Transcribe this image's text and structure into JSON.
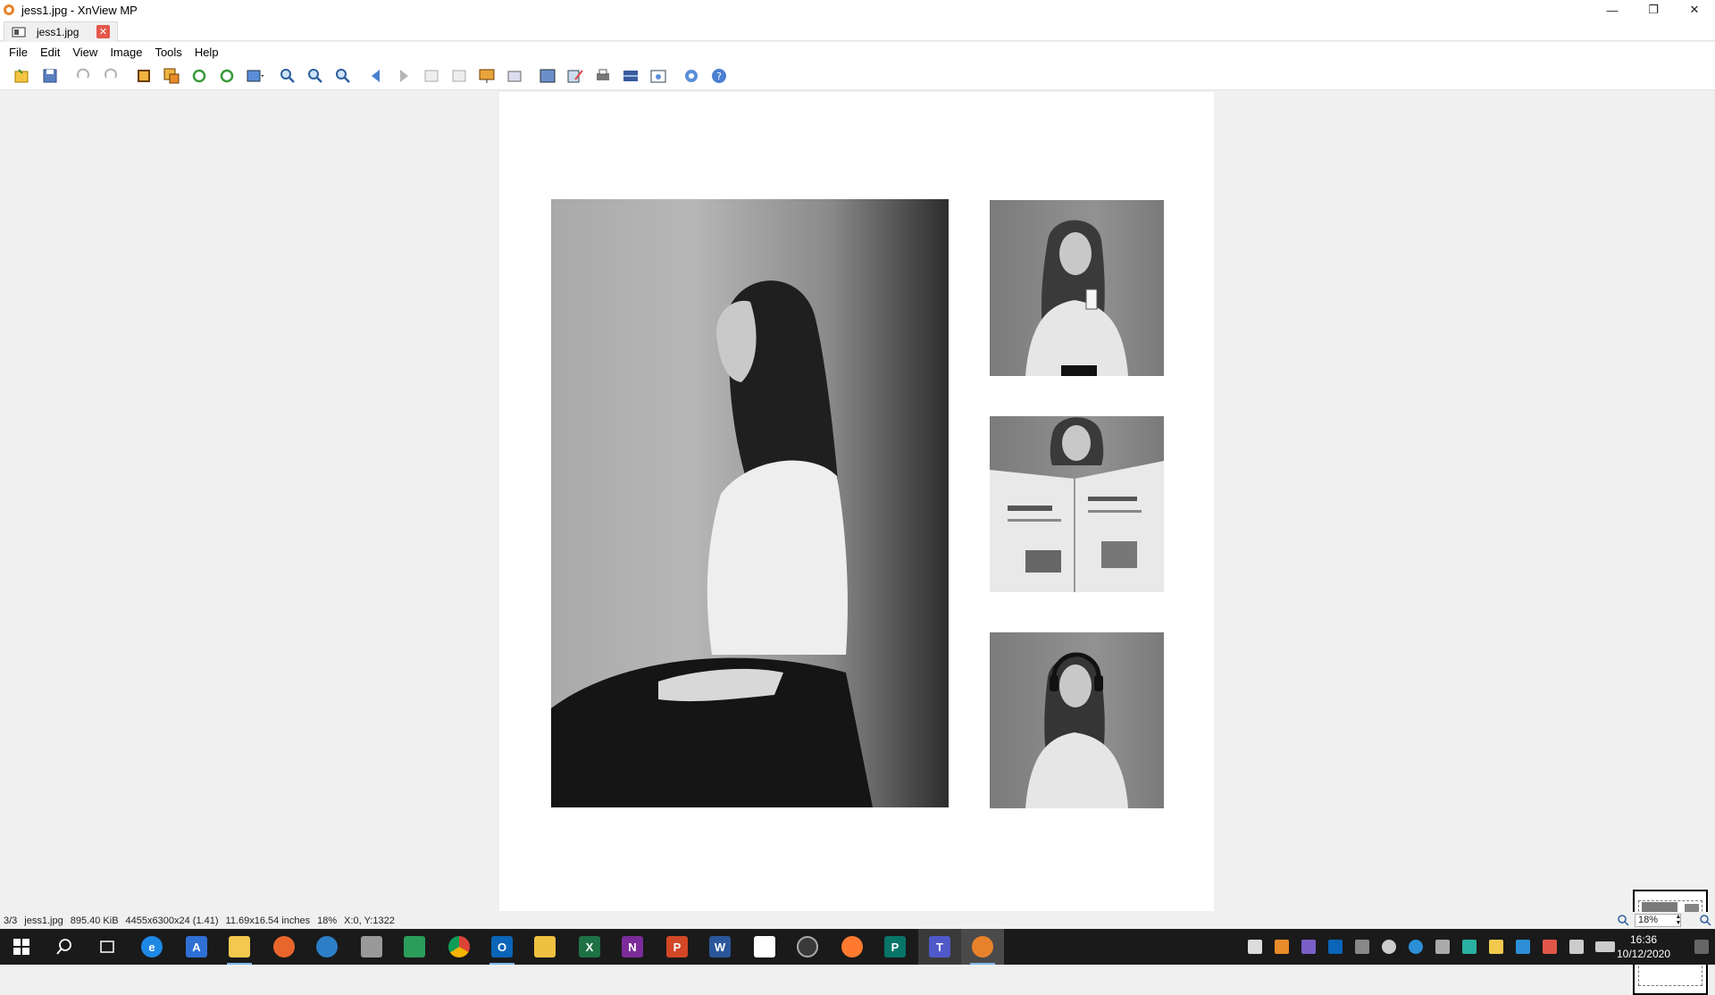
{
  "window": {
    "title": "jess1.jpg - XnView MP",
    "controls": [
      "minimize",
      "restore",
      "close"
    ]
  },
  "tab": {
    "label": "jess1.jpg"
  },
  "menu": [
    "File",
    "Edit",
    "View",
    "Image",
    "Tools",
    "Help"
  ],
  "toolbar": {
    "icons": [
      "browser-icon",
      "save-icon",
      "undo-icon",
      "redo-icon",
      "crop-icon",
      "resize-icon",
      "rotate-left-icon",
      "rotate-right-icon",
      "adjust-icon",
      "zoom-in-icon",
      "zoom-fit-icon",
      "zoom-out-icon",
      "previous-icon",
      "next-icon",
      "first-icon",
      "last-icon",
      "slideshow-icon",
      "fullscreen-icon",
      "compare-icon",
      "edit-icon",
      "print-icon",
      "scan-icon",
      "capture-icon",
      "settings-icon",
      "help-icon"
    ]
  },
  "statusbar": {
    "index": "3/3",
    "filename": "jess1.jpg",
    "filesize": "895.40 KiB",
    "dimensions": "4455x6300x24 (1.41)",
    "print_size": "11.69x16.54 inches",
    "zoom": "18%",
    "cursor": "X:0, Y:1322",
    "zoom_field": "18%"
  },
  "taskbar": {
    "apps": [
      "start",
      "search",
      "task-view",
      "internet-explorer",
      "app-a",
      "file-explorer",
      "firefox",
      "sync",
      "printer",
      "app-grid",
      "chrome",
      "outlook",
      "folder",
      "excel",
      "onenote",
      "powerpoint",
      "word",
      "app-b",
      "app-c",
      "firefox-dev",
      "publisher",
      "teams",
      "xnview"
    ],
    "time": "16:36",
    "date": "10/12/2020"
  },
  "colors": {
    "accent": "#0078d7",
    "close_tab": "#e4574a",
    "taskbar": "#1a1a1a"
  }
}
